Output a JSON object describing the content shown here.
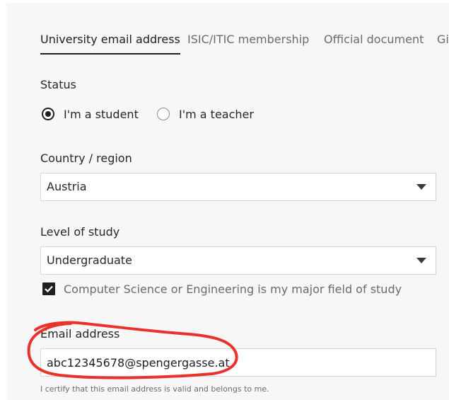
{
  "tabs": [
    {
      "label": "University email address",
      "active": true
    },
    {
      "label": "ISIC/ITIC membership",
      "active": false
    },
    {
      "label": "Official document",
      "active": false
    },
    {
      "label": "Gi",
      "active": false
    }
  ],
  "status": {
    "label": "Status",
    "options": [
      {
        "label": "I'm a student",
        "selected": true
      },
      {
        "label": "I'm a teacher",
        "selected": false
      }
    ]
  },
  "country": {
    "label": "Country / region",
    "value": "Austria"
  },
  "level": {
    "label": "Level of study",
    "value": "Undergraduate"
  },
  "major_checkbox": {
    "label": "Computer Science or Engineering is my major field of study",
    "checked": true
  },
  "email": {
    "label": "Email address",
    "value": "abc12345678@spengergasse.at",
    "hint": "I certify that this email address is valid and belongs to me."
  },
  "colors": {
    "page_background": "#f7f7f7",
    "active_text": "#1f1f1f",
    "muted_text": "#6b6b6b",
    "annotation": "#e8322b"
  },
  "icons": {
    "select_arrow": "chevron-down-icon",
    "checkbox": "checkmark-icon"
  }
}
